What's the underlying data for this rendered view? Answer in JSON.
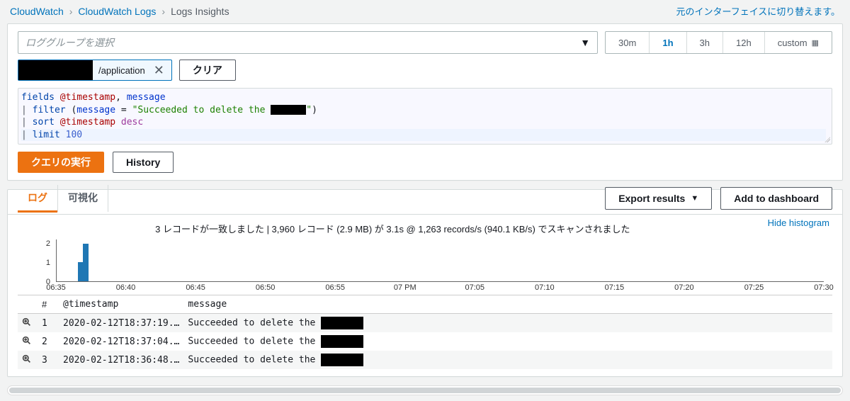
{
  "breadcrumbs": [
    "CloudWatch",
    "CloudWatch Logs",
    "Logs Insights"
  ],
  "switch_link": "元のインターフェイスに切り替えます。",
  "log_group_placeholder": "ロググループを選択",
  "time_ranges": [
    "30m",
    "1h",
    "3h",
    "12h",
    "custom"
  ],
  "time_range_active_index": 1,
  "selected_group_chip": {
    "suffix": "/application"
  },
  "clear_button": "クリア",
  "query": {
    "l1": "fields @timestamp, message",
    "l2_prefix": "| filter (message = \"Succeeded to delete the ",
    "l2_suffix": "\")",
    "l3": "| sort @timestamp desc",
    "l4": "| limit 100"
  },
  "query_tokens": {
    "fields": "fields",
    "ts": "@timestamp",
    "comma": ", ",
    "msg": "message",
    "pipe": "| ",
    "filter": "filter",
    "open": " (",
    "eq": " = ",
    "strA": "\"Succeeded to delete the ",
    "strB": "\"",
    "close": ")",
    "sort": "sort",
    "desc": "desc",
    "limit": "limit",
    "num": "100"
  },
  "run_button": "クエリの実行",
  "history_button": "History",
  "tabs": {
    "log": "ログ",
    "viz": "可視化"
  },
  "export_button": "Export results",
  "add_dashboard_button": "Add to dashboard",
  "hide_histogram": "Hide histogram",
  "summary": "3 レコードが一致しました | 3,960 レコード (2.9 MB) が 3.1s @ 1,263 records/s (940.1 KB/s) でスキャンされました",
  "chart_data": {
    "type": "bar",
    "title": "",
    "xlabel": "",
    "ylabel": "",
    "y_ticks": [
      0,
      1,
      2
    ],
    "ylim": [
      0,
      2.2
    ],
    "x_ticks": [
      "06:35",
      "06:40",
      "06:45",
      "06:50",
      "06:55",
      "07 PM",
      "07:05",
      "07:10",
      "07:15",
      "07:20",
      "07:25",
      "07:30"
    ],
    "bars": [
      {
        "x_tick_index_frac": 0.3,
        "value": 1
      },
      {
        "x_tick_index_frac": 0.38,
        "value": 2
      }
    ]
  },
  "columns": {
    "idx": "#",
    "ts": "@timestamp",
    "msg": "message"
  },
  "rows": [
    {
      "n": "1",
      "ts": "2020-02-12T18:37:19.…",
      "msg": "Succeeded to delete the "
    },
    {
      "n": "2",
      "ts": "2020-02-12T18:37:04.…",
      "msg": "Succeeded to delete the "
    },
    {
      "n": "3",
      "ts": "2020-02-12T18:36:48.…",
      "msg": "Succeeded to delete the "
    }
  ]
}
